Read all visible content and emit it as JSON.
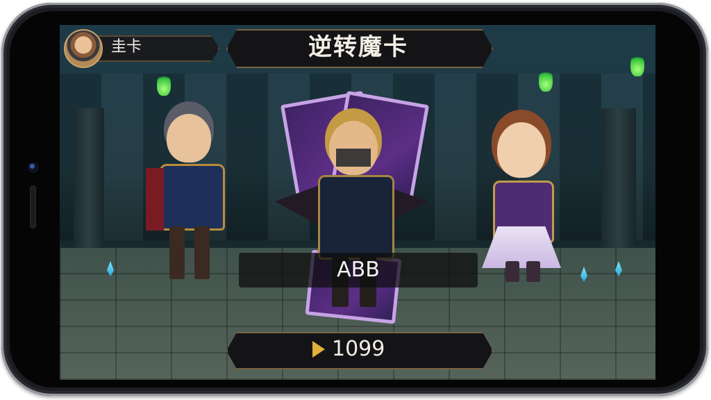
{
  "player": {
    "name": "圭卡"
  },
  "title": "逆转魔卡",
  "selected_character": {
    "name": "ABB"
  },
  "currency": {
    "value": "1099"
  },
  "colors": {
    "accent_gold": "#c9a46a",
    "card_purple": "#5c2e86",
    "torch_green": "#2fbf3a"
  },
  "icons": {
    "currency": "play-triangle-icon",
    "avatar": "avatar-icon"
  }
}
